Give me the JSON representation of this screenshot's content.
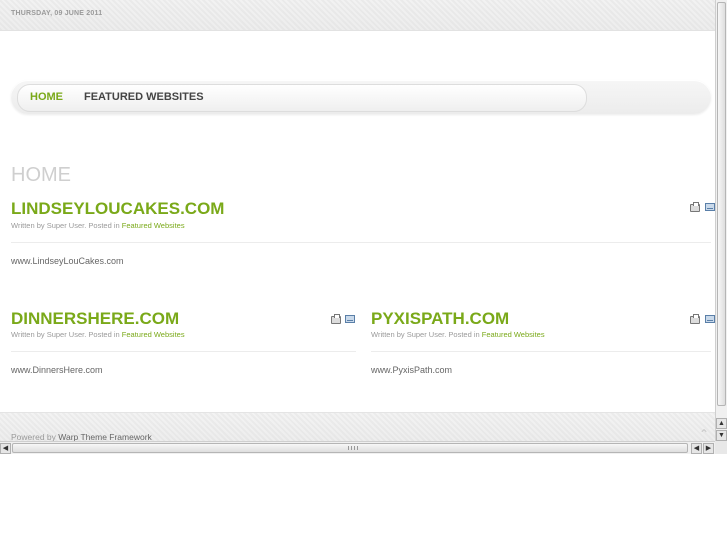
{
  "topbar": {
    "date": "THURSDAY, 09 JUNE 2011"
  },
  "menu": {
    "items": [
      {
        "label": "HOME",
        "active": true
      },
      {
        "label": "FEATURED WEBSITES",
        "active": false
      }
    ]
  },
  "page": {
    "heading": "HOME"
  },
  "articles": [
    {
      "title": "LINDSEYLOUCAKES.COM",
      "meta_prefix": "Written by Super User. Posted in",
      "category": "Featured Websites",
      "body": "www.LindseyLouCakes.com"
    },
    {
      "title": "DINNERSHERE.COM",
      "meta_prefix": "Written by Super User. Posted in",
      "category": "Featured Websites",
      "body": "www.DinnersHere.com"
    },
    {
      "title": "PYXISPATH.COM",
      "meta_prefix": "Written by Super User. Posted in",
      "category": "Featured Websites",
      "body": "www.PyxisPath.com"
    }
  ],
  "icons": {
    "print": "print-icon",
    "email": "email-icon",
    "to_top": "arrow-up-icon"
  },
  "footer": {
    "powered_prefix": "Powered by",
    "powered_link": "Warp Theme Framework"
  },
  "colors": {
    "accent": "#7aa919",
    "heading_muted": "#cfcfcf",
    "text": "#666666"
  }
}
